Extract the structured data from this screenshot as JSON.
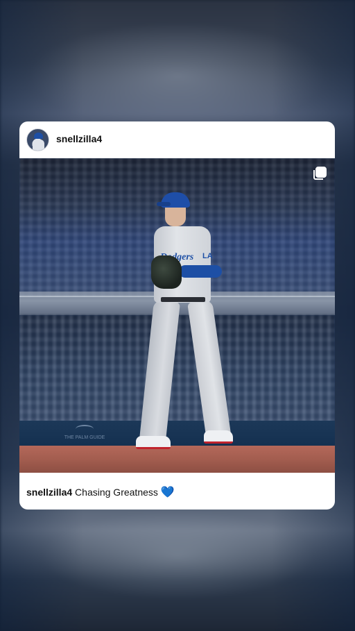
{
  "post": {
    "username": "snellzilla4",
    "caption": {
      "username": "snellzilla4",
      "text": "Chasing Greatness",
      "emoji": "💙"
    },
    "media_type_icon": "multiple-media-icon",
    "photo": {
      "jersey_script": "Dodgers",
      "cap_logo": "LA",
      "wall_sign": "THE PALM GUIDE"
    }
  },
  "colors": {
    "card_background": "#ffffff",
    "heart": "#2f8de4",
    "dodger_blue": "#1d4fa5"
  }
}
